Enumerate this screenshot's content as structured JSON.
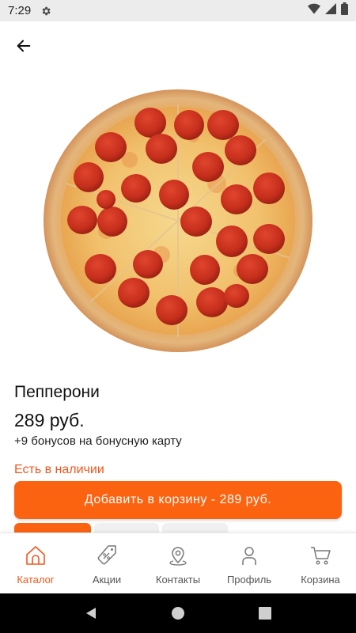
{
  "status_bar": {
    "time": "7:29",
    "icons": [
      "settings-icon",
      "wifi-icon",
      "signal-icon",
      "battery-icon"
    ]
  },
  "product": {
    "image": "pepperoni-pizza-photo",
    "title": "Пепперони",
    "price": "289 руб.",
    "bonus": "+9 бонусов на бонусную карту",
    "stock": "Есть в наличии",
    "add_button": "Добавить в корзину - 289 руб."
  },
  "bottom_nav": {
    "items": [
      {
        "label": "Каталог",
        "icon": "home-icon",
        "active": true
      },
      {
        "label": "Акции",
        "icon": "discount-tag-icon",
        "active": false
      },
      {
        "label": "Контакты",
        "icon": "map-pin-icon",
        "active": false
      },
      {
        "label": "Профиль",
        "icon": "person-icon",
        "active": false
      },
      {
        "label": "Корзина",
        "icon": "cart-icon",
        "active": false
      }
    ]
  },
  "colors": {
    "accent": "#fb6310",
    "accent_text": "#f2561d",
    "nav_inactive": "#555555",
    "system_nav": "#000000"
  }
}
